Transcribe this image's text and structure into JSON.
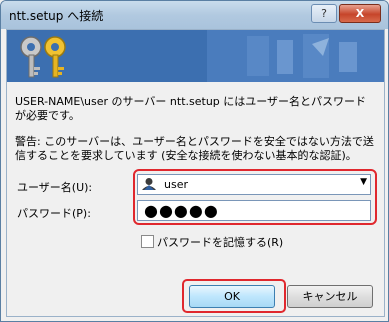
{
  "window": {
    "title": "ntt.setup へ接続",
    "help_label": "?",
    "close_label": "X"
  },
  "message": {
    "line1": "USER-NAME\\user のサーバー ntt.setup にはユーザー名とパスワードが必要です。",
    "line2": "警告: このサーバーは、ユーザー名とパスワードを安全ではない方法で送信することを要求しています (安全な接続を使わない基本的な認証)。"
  },
  "form": {
    "username_label": "ユーザー名(U):",
    "username_value": "user",
    "password_label": "パスワード(P):",
    "password_value": "●●●●●",
    "remember_label": "パスワードを記憶する(R)",
    "remember_checked": false
  },
  "buttons": {
    "ok_label": "OK",
    "cancel_label": "キャンセル"
  },
  "colors": {
    "highlight": "#e0282e",
    "banner": "#3c6fb0"
  },
  "icons": {
    "banner": "keys-icon",
    "user_field": "user-account-icon"
  }
}
